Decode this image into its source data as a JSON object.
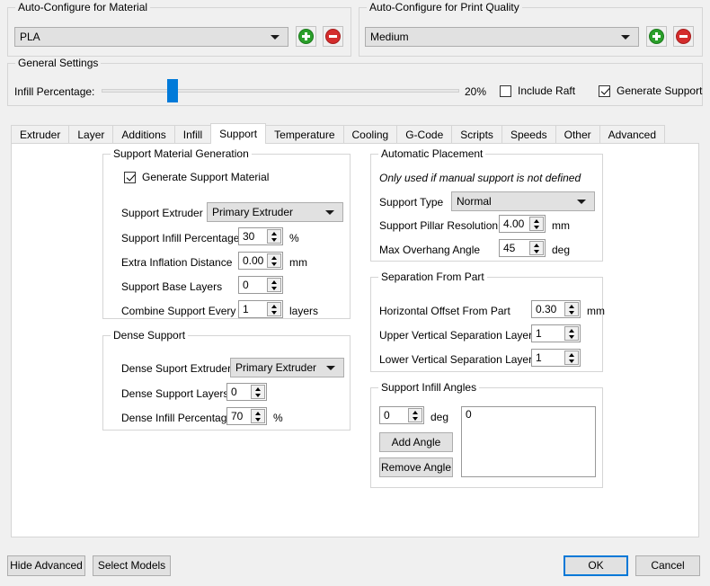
{
  "material_group": {
    "title": "Auto-Configure for Material",
    "selected": "PLA",
    "add_label": "+",
    "remove_label": "-"
  },
  "quality_group": {
    "title": "Auto-Configure for Print Quality",
    "selected": "Medium",
    "add_label": "+",
    "remove_label": "-"
  },
  "general_settings": {
    "title": "General Settings",
    "infill_label": "Infill Percentage:",
    "infill_value": "20%",
    "infill_percent": 20,
    "include_raft": {
      "label": "Include Raft",
      "checked": false
    },
    "generate_support": {
      "label": "Generate Support",
      "checked": true
    }
  },
  "tabs": [
    {
      "label": "Extruder",
      "active": false
    },
    {
      "label": "Layer",
      "active": false
    },
    {
      "label": "Additions",
      "active": false
    },
    {
      "label": "Infill",
      "active": false
    },
    {
      "label": "Support",
      "active": true
    },
    {
      "label": "Temperature",
      "active": false
    },
    {
      "label": "Cooling",
      "active": false
    },
    {
      "label": "G-Code",
      "active": false
    },
    {
      "label": "Scripts",
      "active": false
    },
    {
      "label": "Speeds",
      "active": false
    },
    {
      "label": "Other",
      "active": false
    },
    {
      "label": "Advanced",
      "active": false
    }
  ],
  "support_material_generation": {
    "title": "Support Material Generation",
    "generate_checkbox": {
      "label": "Generate Support Material",
      "checked": true
    },
    "support_extruder": {
      "label": "Support Extruder",
      "value": "Primary Extruder"
    },
    "support_infill_percentage": {
      "label": "Support Infill Percentage",
      "value": "30",
      "unit": "%"
    },
    "extra_inflation_distance": {
      "label": "Extra Inflation Distance",
      "value": "0.00",
      "unit": "mm"
    },
    "support_base_layers": {
      "label": "Support Base Layers",
      "value": "0",
      "unit": ""
    },
    "combine_support_every": {
      "label": "Combine Support Every",
      "value": "1",
      "unit": "layers"
    }
  },
  "dense_support": {
    "title": "Dense Support",
    "dense_support_extruder": {
      "label": "Dense Suport Extruder",
      "value": "Primary Extruder"
    },
    "dense_support_layers": {
      "label": "Dense Support Layers",
      "value": "0",
      "unit": ""
    },
    "dense_infill_percentage": {
      "label": "Dense Infill Percentage",
      "value": "70",
      "unit": "%"
    }
  },
  "automatic_placement": {
    "title": "Automatic Placement",
    "note": "Only used if manual support is not defined",
    "support_type": {
      "label": "Support Type",
      "value": "Normal"
    },
    "support_pillar_resolution": {
      "label": "Support Pillar Resolution",
      "value": "4.00",
      "unit": "mm"
    },
    "max_overhang_angle": {
      "label": "Max Overhang Angle",
      "value": "45",
      "unit": "deg"
    }
  },
  "separation_from_part": {
    "title": "Separation From Part",
    "horizontal_offset": {
      "label": "Horizontal Offset From Part",
      "value": "0.30",
      "unit": "mm"
    },
    "upper_vertical_layers": {
      "label": "Upper Vertical Separation Layers",
      "value": "1",
      "unit": ""
    },
    "lower_vertical_layers": {
      "label": "Lower Vertical Separation Layers",
      "value": "1",
      "unit": ""
    }
  },
  "support_infill_angles": {
    "title": "Support Infill Angles",
    "angle_value": "0",
    "angle_unit": "deg",
    "add_angle_label": "Add Angle",
    "remove_angle_label": "Remove Angle",
    "angles": [
      "0"
    ]
  },
  "footer": {
    "hide_advanced": "Hide Advanced",
    "select_models": "Select Models",
    "ok": "OK",
    "cancel": "Cancel"
  },
  "colors": {
    "accent": "#007ad9",
    "focus": "#0078d7",
    "add_green": "#2aa02a",
    "remove_red": "#d42c2c",
    "window_bg": "#f0f0f0",
    "panel_bg": "#ffffff"
  }
}
